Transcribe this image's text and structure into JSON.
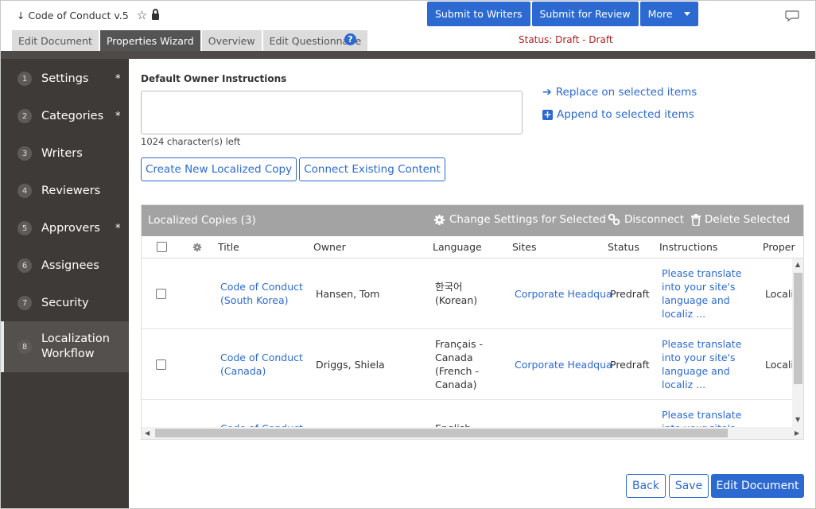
{
  "document": {
    "title": "↓ Code of Conduct v.5"
  },
  "toolbar": {
    "submit_writers": "Submit to Writers",
    "submit_review": "Submit for Review",
    "more": "More"
  },
  "tabs": [
    {
      "label": "Edit Document"
    },
    {
      "label": "Properties Wizard"
    },
    {
      "label": "Overview"
    },
    {
      "label": "Edit Questionnaire"
    }
  ],
  "status": "Status: Draft - Draft",
  "sidebar": {
    "items": [
      {
        "num": "1",
        "label": "Settings",
        "required": "*"
      },
      {
        "num": "2",
        "label": "Categories",
        "required": "*"
      },
      {
        "num": "3",
        "label": "Writers",
        "required": ""
      },
      {
        "num": "4",
        "label": "Reviewers",
        "required": ""
      },
      {
        "num": "5",
        "label": "Approvers",
        "required": "*"
      },
      {
        "num": "6",
        "label": "Assignees",
        "required": ""
      },
      {
        "num": "7",
        "label": "Security",
        "required": ""
      },
      {
        "num": "8",
        "label": "Localization Workflow",
        "label_line1": "Localization",
        "label_line2": "Workflow",
        "required": ""
      }
    ]
  },
  "owner_instructions": {
    "label": "Default Owner Instructions",
    "value": "",
    "chars_left": "1024 character(s) left",
    "replace_link": "Replace on selected items",
    "append_link": "Append to selected items"
  },
  "actions": {
    "create_copy": "Create New Localized Copy",
    "connect_existing": "Connect Existing Content"
  },
  "grid": {
    "title": "Localized Copies (3)",
    "change_settings": "Change Settings for Selected",
    "disconnect": "Disconnect",
    "delete_selected": "Delete Selected",
    "columns": [
      "Title",
      "Owner",
      "Language",
      "Sites",
      "Status",
      "Instructions",
      "Proper"
    ],
    "rows": [
      {
        "title_l1": "Code of Conduct",
        "title_l2": "(South Korea)",
        "owner": "Hansen, Tom",
        "lang_l1": "한국어",
        "lang_l2": "(Korean)",
        "lang_l3": "",
        "lang_l4": "",
        "site": "Corporate Headqua",
        "status": "Predraft",
        "instr_l1": "Please translate",
        "instr_l2": "into your site's",
        "instr_l3": "language and",
        "instr_l4": "localiz ...",
        "prop": "Locali"
      },
      {
        "title_l1": "Code of Conduct",
        "title_l2": "(Canada)",
        "owner": "Driggs, Shiela",
        "lang_l1": "Français -",
        "lang_l2": "Canada",
        "lang_l3": "(French -",
        "lang_l4": "Canada)",
        "site": "Corporate Headqua",
        "status": "Predraft",
        "instr_l1": "Please translate",
        "instr_l2": "into your site's",
        "instr_l3": "language and",
        "instr_l4": "localiz ...",
        "prop": "Locali"
      },
      {
        "title_l1": "Code of Conduct",
        "title_l2": "",
        "owner": "",
        "lang_l1": "English",
        "lang_l2": "",
        "lang_l3": "",
        "lang_l4": "",
        "site": "",
        "status": "",
        "instr_l1": "Please translate",
        "instr_l2": "into your site's",
        "instr_l3": "",
        "instr_l4": "",
        "prop": ""
      }
    ]
  },
  "footer": {
    "back": "Back",
    "save": "Save",
    "edit_document": "Edit Document"
  },
  "colors": {
    "accent": "#2c6ad2",
    "sidebar_bg": "#3e3a37",
    "status_red": "#b22222"
  }
}
